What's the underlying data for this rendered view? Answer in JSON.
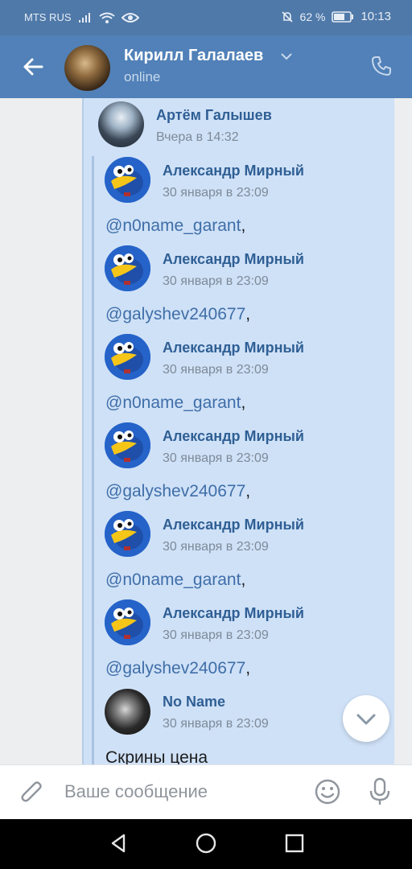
{
  "status_bar": {
    "carrier": "MTS RUS",
    "battery_percent": "62 %",
    "time": "10:13",
    "icons": [
      "signal-icon",
      "wifi-icon",
      "eye-icon",
      "mute-icon",
      "battery-icon"
    ]
  },
  "header": {
    "contact_name": "Кирилл Галалаев",
    "status": "online",
    "icons": [
      "back-arrow-icon",
      "chevron-down-icon",
      "phone-icon"
    ]
  },
  "messages": [
    {
      "author": "Артём Галышев",
      "date": "Вчера в 14:32",
      "avatar": "photo-dark"
    },
    {
      "author": "Александр Мирный",
      "date": "30 января в 23:09",
      "text": "@n0name_garant",
      "suffix": ",",
      "avatar": "bird"
    },
    {
      "author": "Александр Мирный",
      "date": "30 января в 23:09",
      "text": "@galyshev240677",
      "suffix": ",",
      "avatar": "bird"
    },
    {
      "author": "Александр Мирный",
      "date": "30 января в 23:09",
      "text": "@n0name_garant",
      "suffix": ",",
      "avatar": "bird"
    },
    {
      "author": "Александр Мирный",
      "date": "30 января в 23:09",
      "text": "@galyshev240677",
      "suffix": ",",
      "avatar": "bird"
    },
    {
      "author": "Александр Мирный",
      "date": "30 января в 23:09",
      "text": "@n0name_garant",
      "suffix": ",",
      "avatar": "bird"
    },
    {
      "author": "Александр Мирный",
      "date": "30 января в 23:09",
      "text": "@galyshev240677",
      "suffix": ",",
      "avatar": "bird"
    },
    {
      "author": "No Name",
      "date": "30 января в 23:09",
      "text": "Скрины цена",
      "avatar": "photo-dark"
    }
  ],
  "composer": {
    "placeholder": "Ваше сообщение",
    "icons": [
      "paperclip-icon",
      "smile-icon",
      "microphone-icon"
    ]
  },
  "nav": {
    "icons": [
      "nav-back-icon",
      "nav-home-icon",
      "nav-recents-icon"
    ]
  },
  "colors": {
    "header_blue": "#5181b8",
    "bubble": "#cfe1f7",
    "link": "#3f6ea8",
    "name": "#2f5f94"
  }
}
